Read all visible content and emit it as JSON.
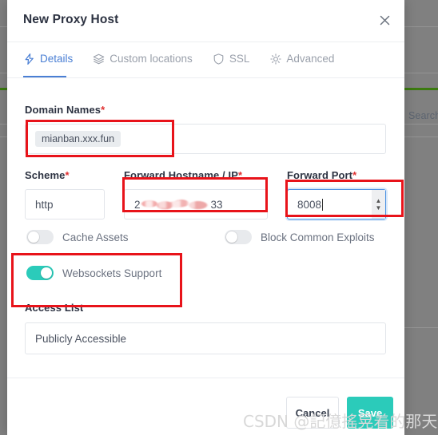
{
  "backdrop": {
    "search_placeholder": "Search"
  },
  "modal": {
    "title": "New Proxy Host",
    "close_icon": "close-icon",
    "tabs": [
      {
        "label": "Details",
        "icon": "lightning-bolt-icon",
        "active": true
      },
      {
        "label": "Custom locations",
        "icon": "layers-icon",
        "active": false
      },
      {
        "label": "SSL",
        "icon": "shield-icon",
        "active": false
      },
      {
        "label": "Advanced",
        "icon": "gear-icon",
        "active": false
      }
    ],
    "fields": {
      "domain_names": {
        "label": "Domain Names",
        "required_marker": "*",
        "chips": [
          "mianban.xxx.fun"
        ]
      },
      "scheme": {
        "label": "Scheme",
        "required_marker": "*",
        "value": "http"
      },
      "forward_hostname": {
        "label": "Forward Hostname / IP",
        "required_marker": "*",
        "value_prefix": "2",
        "value_suffix": "33",
        "redacted": true
      },
      "forward_port": {
        "label": "Forward Port",
        "required_marker": "*",
        "value": "8008",
        "focused": true,
        "spinner_up": "▲",
        "spinner_down": "▼"
      },
      "access_list": {
        "label": "Access List",
        "value": "Publicly Accessible"
      }
    },
    "toggles": [
      {
        "label": "Cache Assets",
        "on": false
      },
      {
        "label": "Block Common Exploits",
        "on": false
      },
      {
        "label": "Websockets Support",
        "on": true
      }
    ],
    "footer": {
      "cancel_label": "Cancel",
      "save_label": "Save"
    }
  },
  "annotations": {
    "color": "#e8131a",
    "boxes": [
      "domain-names-field",
      "forward-hostname-field",
      "forward-port-field",
      "websockets-support-toggle"
    ]
  },
  "watermark": {
    "text": "CSDN @記億搖晃着的那天"
  },
  "colors": {
    "accent_teal": "#2bcbba",
    "tab_active_blue": "#4a7fd4",
    "required_red": "#e03131",
    "annotation_red": "#e8131a",
    "backdrop_gray": "#808080",
    "backdrop_green_line": "#3b7a0f"
  }
}
